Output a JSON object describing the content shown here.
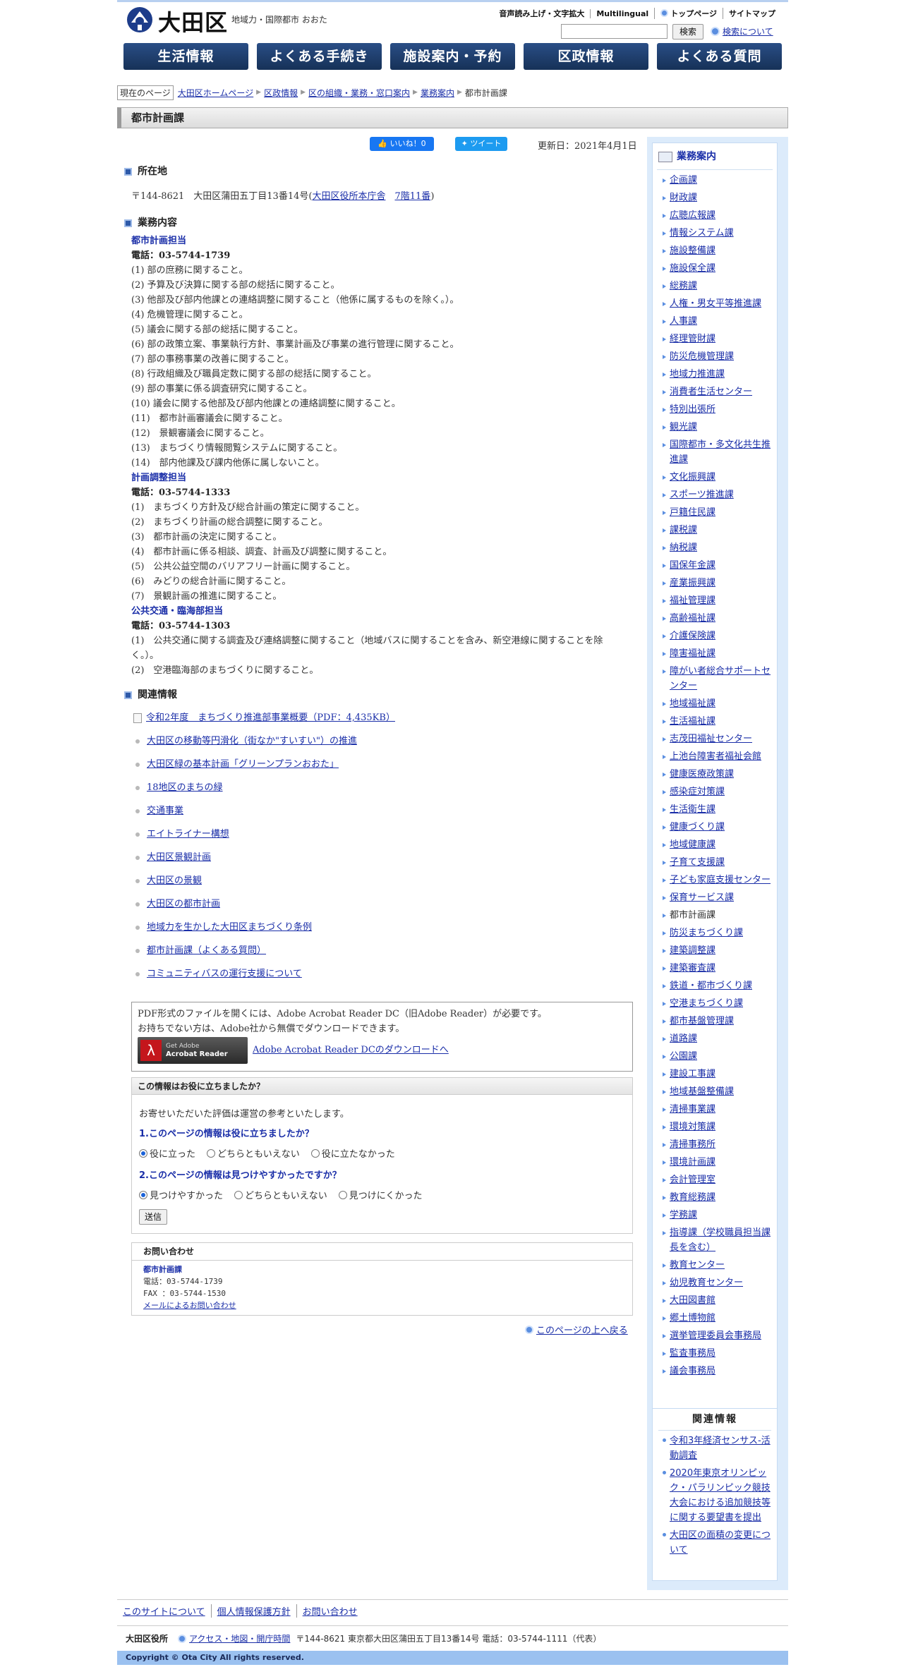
{
  "header": {
    "logo_text": "大田区",
    "logo_sub": "地域力・国際都市 おおた",
    "util": [
      "音声読み上げ・文字拡大",
      "Multilingual",
      "トップページ",
      "サイトマップ"
    ],
    "search_button": "検索",
    "search_help": "検索について"
  },
  "gnav": [
    "生活情報",
    "よくある手続き",
    "施設案内・予約",
    "区政情報",
    "よくある質問"
  ],
  "breadcrumb": {
    "here_label": "現在のページ",
    "links": [
      "大田区ホームページ",
      "区政情報",
      "区の組織・業務・窓口案内",
      "業務案内"
    ],
    "current": "都市計画課"
  },
  "page_title": "都市計画課",
  "social": {
    "like": "いいね！0",
    "tweet": "ツイート"
  },
  "updated": "更新日：2021年4月1日",
  "location": {
    "heading": "所在地",
    "address_prefix": "〒144-8621　大田区蒲田五丁目13番14号(",
    "link1": "大田区役所本庁舎",
    "link2": "7階11番",
    "suffix": ")"
  },
  "duties": {
    "heading": "業務内容",
    "teams": [
      {
        "name": "都市計画担当",
        "tel": "電話：03-5744-1739",
        "items": [
          "(1) 部の庶務に関すること。",
          "(2) 予算及び決算に関する部の総括に関すること。",
          "(3) 他部及び部内他課との連絡調整に関すること（他係に属するものを除く。）。",
          "(4) 危機管理に関すること。",
          "(5) 議会に関する部の総括に関すること。",
          "(6) 部の政策立案、事業執行方針、事業計画及び事業の進行管理に関すること。",
          "(7) 部の事務事業の改善に関すること。",
          "(8) 行政組織及び職員定数に関する部の総括に関すること。",
          "(9) 部の事業に係る調査研究に関すること。",
          "(10) 議会に関する他部及び部内他課との連絡調整に関すること。",
          "(11)　都市計画審議会に関すること。",
          "(12)　景観審議会に関すること。",
          "(13)　まちづくり情報閲覧システムに関すること。",
          "(14)　部内他課及び課内他係に属しないこと。"
        ]
      },
      {
        "name": "計画調整担当",
        "tel": "電話：03-5744-1333",
        "items": [
          "(1)　まちづくり方針及び総合計画の策定に関すること。",
          "(2)　まちづくり計画の総合調整に関すること。",
          "(3)　都市計画の決定に関すること。",
          "(4)　都市計画に係る相談、調査、計画及び調整に関すること。",
          "(5)　公共公益空間のバリアフリー計画に関すること。",
          "(6)　みどりの総合計画に関すること。",
          "(7)　景観計画の推進に関すること。"
        ]
      },
      {
        "name": "公共交通・臨海部担当",
        "tel": "電話：03-5744-1303",
        "items": [
          "(1)　公共交通に関する調査及び連絡調整に関すること（地域バスに関することを含み、新空港線に関することを除",
          "く。）。",
          "(2)　空港臨海部のまちづくりに関すること。"
        ]
      }
    ]
  },
  "related": {
    "heading": "関連情報",
    "pdf_item": "令和2年度　まちづくり推進部事業概要（PDF：4,435KB）",
    "items": [
      "大田区の移動等円滑化（街なか\"すいすい\"）の推進",
      "大田区緑の基本計画「グリーンプランおおた」",
      "18地区のまちの緑",
      "交通事業",
      "エイトライナー構想",
      "大田区景観計画",
      "大田区の景観",
      "大田区の都市計画",
      "地域力を生かした大田区まちづくり条例",
      "都市計画課（よくある質問）",
      "コミュニティバスの運行支援について"
    ]
  },
  "pdf_notice": {
    "line1": "PDF形式のファイルを開くには、Adobe Acrobat Reader DC（旧Adobe Reader）が必要です。",
    "line2": "お持ちでない方は、Adobe社から無償でダウンロードできます。",
    "badge_line1": "Get Adobe",
    "badge_line2": "Acrobat Reader",
    "link": "Adobe Acrobat Reader DCのダウンロードへ"
  },
  "survey": {
    "heading": "この情報はお役に立ちましたか？",
    "lead": "お寄せいただいた評価は運営の参考といたします。",
    "q1": "1.このページの情報は役に立ちましたか？",
    "q1_opts": [
      "役に立った",
      "どちらともいえない",
      "役に立たなかった"
    ],
    "q2": "2.このページの情報は見つけやすかったですか？",
    "q2_opts": [
      "見つけやすかった",
      "どちらともいえない",
      "見つけにくかった"
    ],
    "submit": "送信"
  },
  "contact": {
    "heading": "お問い合わせ",
    "name": "都市計画課",
    "tel": "電話：03-5744-1739",
    "fax": "FAX ：03-5744-1530",
    "mail": "メールによるお問い合わせ"
  },
  "pagetop": "このページの上へ戻る",
  "sidebar": {
    "heading": "業務案内",
    "items": [
      "企画課",
      "財政課",
      "広聴広報課",
      "情報システム課",
      "施設整備課",
      "施設保全課",
      "総務課",
      "人権・男女平等推進課",
      "人事課",
      "経理管財課",
      "防災危機管理課",
      "地域力推進課",
      "消費者生活センター",
      "特別出張所",
      "観光課",
      "国際都市・多文化共生推進課",
      "文化振興課",
      "スポーツ推進課",
      "戸籍住民課",
      "課税課",
      "納税課",
      "国保年金課",
      "産業振興課",
      "福祉管理課",
      "高齢福祉課",
      "介護保険課",
      "障害福祉課",
      "障がい者総合サポートセンター",
      "地域福祉課",
      "生活福祉課",
      "志茂田福祉センター",
      "上池台障害者福祉会館",
      "健康医療政策課",
      "感染症対策課",
      "生活衛生課",
      "健康づくり課",
      "地域健康課",
      "子育て支援課",
      "子ども家庭支援センター",
      "保育サービス課",
      "都市計画課",
      "防災まちづくり課",
      "建築調整課",
      "建築審査課",
      "鉄道・都市づくり課",
      "空港まちづくり課",
      "都市基盤管理課",
      "道路課",
      "公園課",
      "建設工事課",
      "地域基盤整備課",
      "清掃事業課",
      "環境対策課",
      "清掃事務所",
      "環境計画課",
      "会計管理室",
      "教育総務課",
      "学務課",
      "指導課（学校職員担当課長を含む）",
      "教育センター",
      "幼児教育センター",
      "大田図書館",
      "郷土博物館",
      "選挙管理委員会事務局",
      "監査事務局",
      "議会事務局"
    ],
    "current": "都市計画課",
    "related_heading": "関連情報",
    "related": [
      "令和3年経済センサス-活動調査",
      "2020年東京オリンピック・パラリンピック競技大会における追加競技等に関する要望書を提出",
      "大田区の面積の変更について"
    ]
  },
  "footer": {
    "links": [
      "このサイトについて",
      "個人情報保護方針",
      "お問い合わせ"
    ],
    "org": "大田区役所",
    "access": "アクセス・地図・開庁時間",
    "address": "〒144-8621 東京都大田区蒲田五丁目13番14号 電話：03-5744-1111（代表）",
    "copyright": "Copyright © Ota City All rights reserved."
  }
}
